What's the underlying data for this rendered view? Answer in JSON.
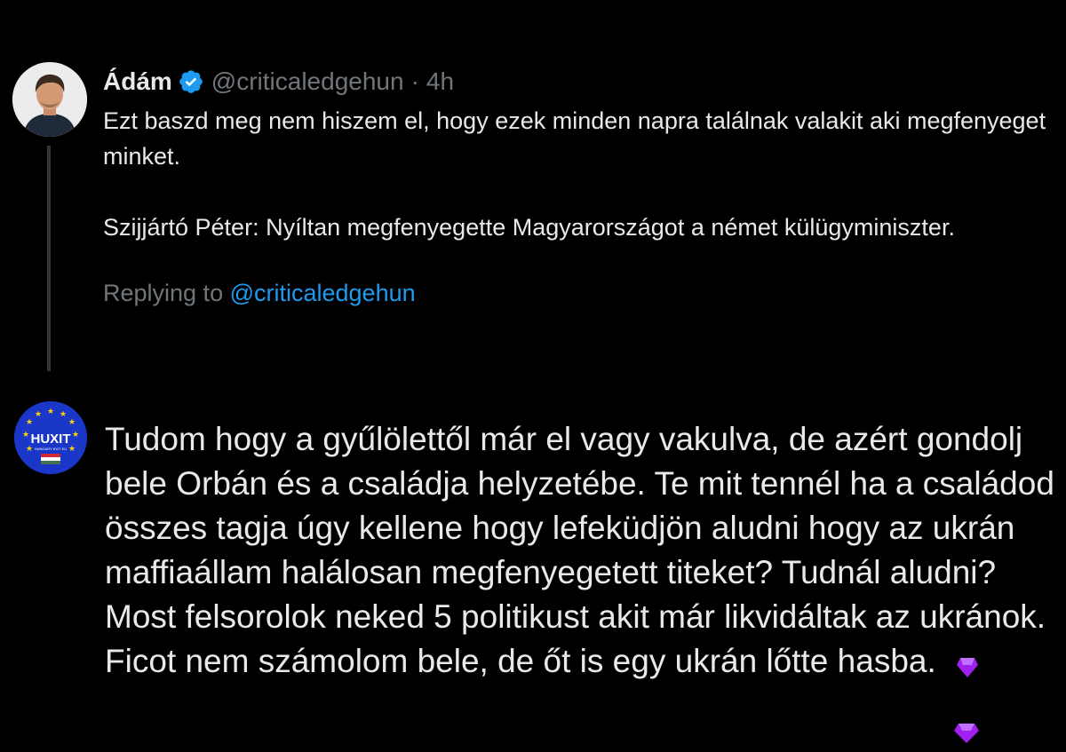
{
  "quoted_tweet": {
    "display_name": "Ádám",
    "handle": "@criticaledgehun",
    "separator": "·",
    "time": "4h",
    "text_paragraph_1": "Ezt baszd meg nem hiszem el, hogy ezek minden napra találnak valakit aki megfenyeget minket.",
    "text_paragraph_2": "Szijjártó Péter: Nyíltan megfenyegette Magyarországot a német külügyminiszter.",
    "replying_prefix": "Replying to ",
    "replying_handle": "@criticaledgehun"
  },
  "reply_tweet": {
    "avatar_text": "HUXIT",
    "avatar_subtext": "HUNGARY EXIT EU",
    "text": "Tudom hogy a gyűlölettől már el vagy vakulva, de azért gondolj bele Orbán és a családja helyzetébe. Te mit tennél ha a családod összes tagja úgy kellene hogy lefeküdjön aludni hogy az ukrán maffiaállam halálosan megfenyegetett titeket? Tudnál aludni?  Most felsorolok neked 5 politikust akit már likvidáltak az ukránok. Ficot nem számolom bele, de őt is egy ukrán lőtte hasba."
  },
  "colors": {
    "background": "#000000",
    "text_primary": "#e7e9ea",
    "text_secondary": "#71767b",
    "link": "#1d9bf0",
    "verified_badge": "#1d9bf0",
    "thread_line": "#333639",
    "huxit_blue": "#1a37c8",
    "gem_purple": "#a020f0"
  }
}
